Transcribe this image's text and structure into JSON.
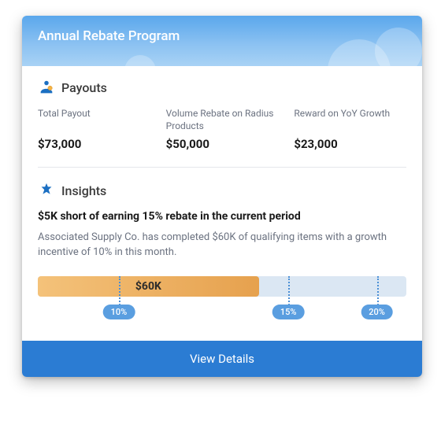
{
  "header": {
    "title": "Annual Rebate Program"
  },
  "payouts": {
    "section_title": "Payouts",
    "stats": [
      {
        "label": "Total\nPayout",
        "value": "$73,000"
      },
      {
        "label": "Volume Rebate on Radius Products",
        "value": "$50,000"
      },
      {
        "label": "Reward on\nYoY Growth",
        "value": "$23,000"
      }
    ]
  },
  "insights": {
    "section_title": "Insights",
    "heading": "$5K short of earning 15% rebate in the current period",
    "body": "Associated Supply Co. has completed $60K of qualifying items with a growth incentive of 10% in this month.",
    "progress": {
      "current_label": "$60K",
      "fill_percent": 60,
      "ticks": [
        {
          "position_percent": 22,
          "label": "10%"
        },
        {
          "position_percent": 68,
          "label": "15%"
        },
        {
          "position_percent": 92,
          "label": "20%"
        }
      ]
    }
  },
  "footer": {
    "view_details": "View Details"
  },
  "colors": {
    "brand_blue": "#2b7cd3",
    "accent_orange": "#e6a14e",
    "track_blue": "#dbe7f3"
  }
}
